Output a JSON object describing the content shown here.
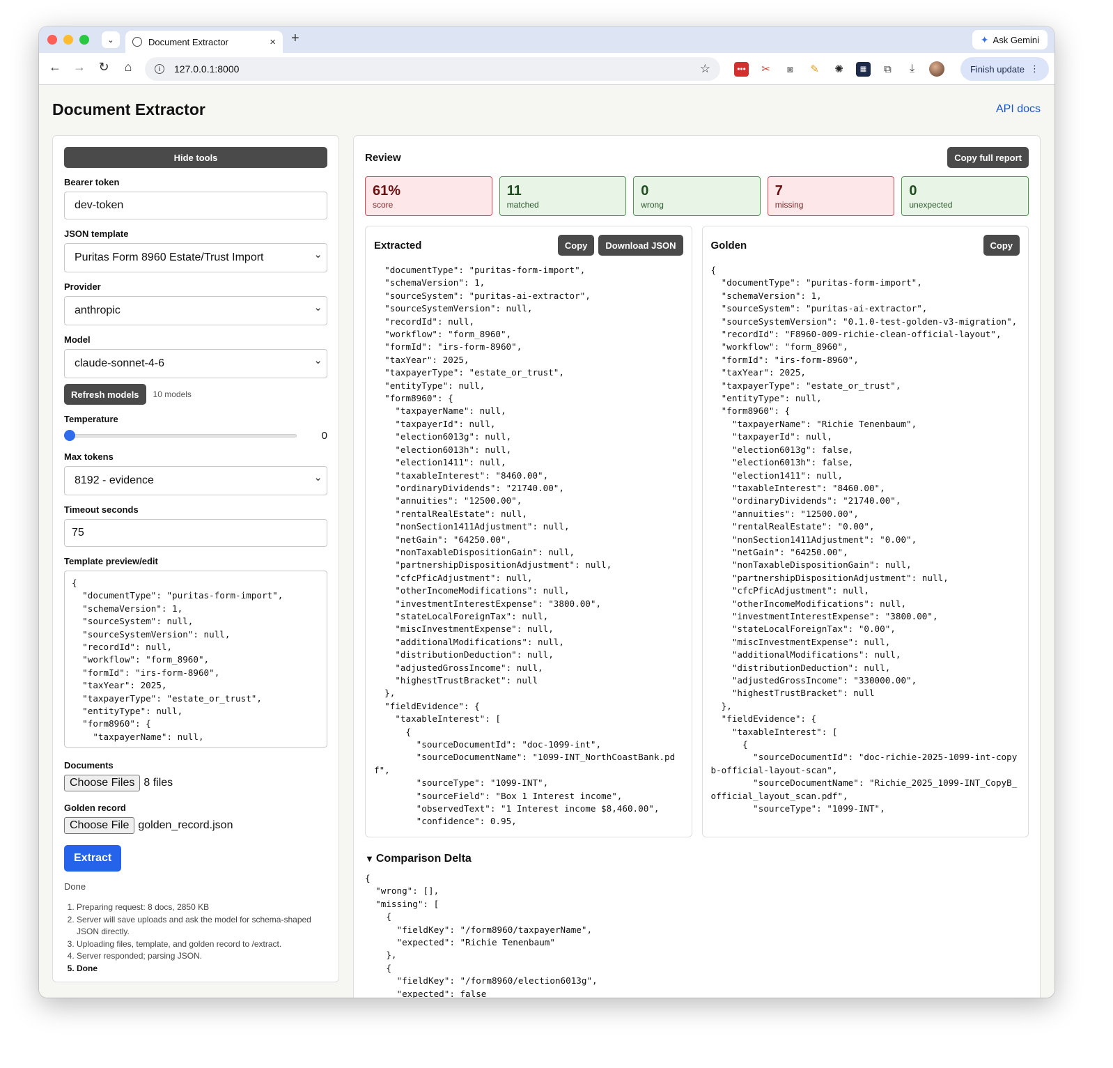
{
  "browser": {
    "tab_title": "Document Extractor",
    "tab_close": "×",
    "new_tab": "+",
    "gemini_label": "Ask Gemini",
    "url": "127.0.0.1:8000",
    "finish_update": "Finish update",
    "icons": [
      "back-icon",
      "forward-icon",
      "reload-icon",
      "home-icon",
      "info-icon",
      "star-icon",
      "extension-icons",
      "download-icon",
      "profile-avatar"
    ]
  },
  "header": {
    "title": "Document Extractor",
    "api_docs": "API docs"
  },
  "tools": {
    "hide_tools": "Hide tools",
    "bearer_label": "Bearer token",
    "bearer_value": "dev-token",
    "template_label": "JSON template",
    "template_value": "Puritas Form 8960 Estate/Trust Import",
    "provider_label": "Provider",
    "provider_value": "anthropic",
    "model_label": "Model",
    "model_value": "claude-sonnet-4-6",
    "refresh_models": "Refresh models",
    "models_count": "10 models",
    "temperature_label": "Temperature",
    "temperature_value": "0",
    "temperature_fraction": 0,
    "max_tokens_label": "Max tokens",
    "max_tokens_value": "8192 - evidence",
    "timeout_label": "Timeout seconds",
    "timeout_value": "75",
    "template_preview_label": "Template preview/edit",
    "template_preview": "{\n  \"documentType\": \"puritas-form-import\",\n  \"schemaVersion\": 1,\n  \"sourceSystem\": null,\n  \"sourceSystemVersion\": null,\n  \"recordId\": null,\n  \"workflow\": \"form_8960\",\n  \"formId\": \"irs-form-8960\",\n  \"taxYear\": 2025,\n  \"taxpayerType\": \"estate_or_trust\",\n  \"entityType\": null,\n  \"form8960\": {\n    \"taxpayerName\": null,",
    "documents_label": "Documents",
    "choose_files": "Choose Files",
    "documents_value": "8 files",
    "golden_label": "Golden record",
    "choose_file": "Choose File",
    "golden_value": "golden_record.json",
    "extract": "Extract",
    "status": "Done",
    "steps": [
      "Preparing request: 8 docs, 2850 KB",
      "Server will save uploads and ask the model for schema-shaped JSON directly.",
      "Uploading files, template, and golden record to /extract.",
      "Server responded; parsing JSON.",
      "Done"
    ]
  },
  "review": {
    "title": "Review",
    "copy_full_report": "Copy full report",
    "stats": [
      {
        "value": "61%",
        "caption": "score",
        "kind": "bad"
      },
      {
        "value": "11",
        "caption": "matched",
        "kind": "good"
      },
      {
        "value": "0",
        "caption": "wrong",
        "kind": "good"
      },
      {
        "value": "7",
        "caption": "missing",
        "kind": "bad"
      },
      {
        "value": "0",
        "caption": "unexpected",
        "kind": "good"
      }
    ],
    "extracted": {
      "title": "Extracted",
      "copy": "Copy",
      "download": "Download JSON",
      "json": "  \"documentType\": \"puritas-form-import\",\n  \"schemaVersion\": 1,\n  \"sourceSystem\": \"puritas-ai-extractor\",\n  \"sourceSystemVersion\": null,\n  \"recordId\": null,\n  \"workflow\": \"form_8960\",\n  \"formId\": \"irs-form-8960\",\n  \"taxYear\": 2025,\n  \"taxpayerType\": \"estate_or_trust\",\n  \"entityType\": null,\n  \"form8960\": {\n    \"taxpayerName\": null,\n    \"taxpayerId\": null,\n    \"election6013g\": null,\n    \"election6013h\": null,\n    \"election1411\": null,\n    \"taxableInterest\": \"8460.00\",\n    \"ordinaryDividends\": \"21740.00\",\n    \"annuities\": \"12500.00\",\n    \"rentalRealEstate\": null,\n    \"nonSection1411Adjustment\": null,\n    \"netGain\": \"64250.00\",\n    \"nonTaxableDispositionGain\": null,\n    \"partnershipDispositionAdjustment\": null,\n    \"cfcPficAdjustment\": null,\n    \"otherIncomeModifications\": null,\n    \"investmentInterestExpense\": \"3800.00\",\n    \"stateLocalForeignTax\": null,\n    \"miscInvestmentExpense\": null,\n    \"additionalModifications\": null,\n    \"distributionDeduction\": null,\n    \"adjustedGrossIncome\": null,\n    \"highestTrustBracket\": null\n  },\n  \"fieldEvidence\": {\n    \"taxableInterest\": [\n      {\n        \"sourceDocumentId\": \"doc-1099-int\",\n        \"sourceDocumentName\": \"1099-INT_NorthCoastBank.pdf\",\n        \"sourceType\": \"1099-INT\",\n        \"sourceField\": \"Box 1 Interest income\",\n        \"observedText\": \"1 Interest income $8,460.00\",\n        \"confidence\": 0.95,"
    },
    "golden": {
      "title": "Golden",
      "copy": "Copy",
      "json": "{\n  \"documentType\": \"puritas-form-import\",\n  \"schemaVersion\": 1,\n  \"sourceSystem\": \"puritas-ai-extractor\",\n  \"sourceSystemVersion\": \"0.1.0-test-golden-v3-migration\",\n  \"recordId\": \"F8960-009-richie-clean-official-layout\",\n  \"workflow\": \"form_8960\",\n  \"formId\": \"irs-form-8960\",\n  \"taxYear\": 2025,\n  \"taxpayerType\": \"estate_or_trust\",\n  \"entityType\": null,\n  \"form8960\": {\n    \"taxpayerName\": \"Richie Tenenbaum\",\n    \"taxpayerId\": null,\n    \"election6013g\": false,\n    \"election6013h\": false,\n    \"election1411\": null,\n    \"taxableInterest\": \"8460.00\",\n    \"ordinaryDividends\": \"21740.00\",\n    \"annuities\": \"12500.00\",\n    \"rentalRealEstate\": \"0.00\",\n    \"nonSection1411Adjustment\": \"0.00\",\n    \"netGain\": \"64250.00\",\n    \"nonTaxableDispositionGain\": null,\n    \"partnershipDispositionAdjustment\": null,\n    \"cfcPficAdjustment\": null,\n    \"otherIncomeModifications\": null,\n    \"investmentInterestExpense\": \"3800.00\",\n    \"stateLocalForeignTax\": \"0.00\",\n    \"miscInvestmentExpense\": null,\n    \"additionalModifications\": null,\n    \"distributionDeduction\": null,\n    \"adjustedGrossIncome\": \"330000.00\",\n    \"highestTrustBracket\": null\n  },\n  \"fieldEvidence\": {\n    \"taxableInterest\": [\n      {\n        \"sourceDocumentId\": \"doc-richie-2025-1099-int-copyb-official-layout-scan\",\n        \"sourceDocumentName\": \"Richie_2025_1099-INT_CopyB_official_layout_scan.pdf\",\n        \"sourceType\": \"1099-INT\","
    },
    "delta": {
      "title": "Comparison Delta",
      "json": "{\n  \"wrong\": [],\n  \"missing\": [\n    {\n      \"fieldKey\": \"/form8960/taxpayerName\",\n      \"expected\": \"Richie Tenenbaum\"\n    },\n    {\n      \"fieldKey\": \"/form8960/election6013g\",\n      \"expected\": false"
    }
  }
}
